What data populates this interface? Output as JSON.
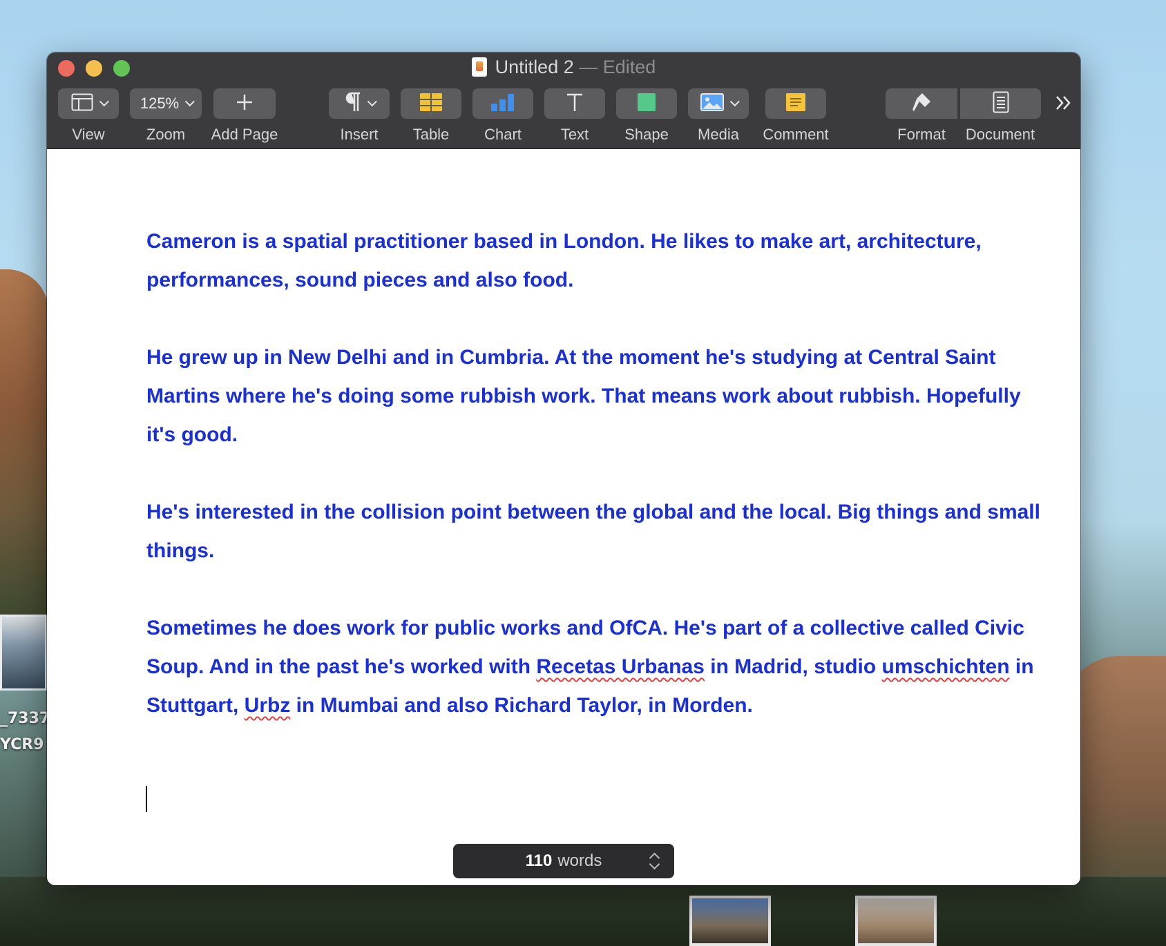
{
  "desktop": {
    "labels": [
      "_7337",
      "YCR9"
    ]
  },
  "window": {
    "title": "Untitled 2",
    "title_suffix": "— Edited"
  },
  "toolbar": {
    "view": {
      "label": "View",
      "icon": "sidebar-layout-icon"
    },
    "zoom": {
      "label": "Zoom",
      "value": "125%"
    },
    "add_page": {
      "label": "Add Page",
      "icon": "plus-icon"
    },
    "insert": {
      "label": "Insert",
      "icon": "pilcrow-icon"
    },
    "table": {
      "label": "Table",
      "icon": "table-icon",
      "color": "#f2c230"
    },
    "chart": {
      "label": "Chart",
      "icon": "bar-chart-icon",
      "color": "#3d8ff0"
    },
    "text": {
      "label": "Text",
      "icon": "text-icon"
    },
    "shape": {
      "label": "Shape",
      "icon": "square-icon",
      "color": "#55c98a"
    },
    "media": {
      "label": "Media",
      "icon": "photo-icon",
      "color": "#5aa4f5"
    },
    "comment": {
      "label": "Comment",
      "icon": "comment-icon",
      "color": "#f5c43a"
    },
    "format": {
      "label": "Format",
      "icon": "paintbrush-icon"
    },
    "document": {
      "label": "Document",
      "icon": "document-icon"
    },
    "more": {
      "icon": "double-chevron-icon"
    }
  },
  "document": {
    "p1": "Cameron is a spatial practitioner based in London. He likes to make art, architecture, performances, sound pieces and also food.",
    "p2": "He grew up in New Delhi and in Cumbria. At the moment he's studying at Central Saint Martins where he's doing some rubbish work. That means work about rubbish. Hopefully it's good.",
    "p3": "He's interested in the collision point between the global and the local. Big things and small things.",
    "p4": {
      "a": "Sometimes he does work for public works and OfCA. He's part of a collective called Civic Soup. And in the past he's worked with ",
      "b": "Recetas Urbanas",
      "c": " in Madrid, studio ",
      "d": "umschichten",
      "e": " in Stuttgart, ",
      "f": "Urbz",
      "g": " in Mumbai and also Richard Taylor, in Morden."
    },
    "text_color": "#1a2fd6"
  },
  "word_count": {
    "count": "110",
    "unit": "words"
  }
}
